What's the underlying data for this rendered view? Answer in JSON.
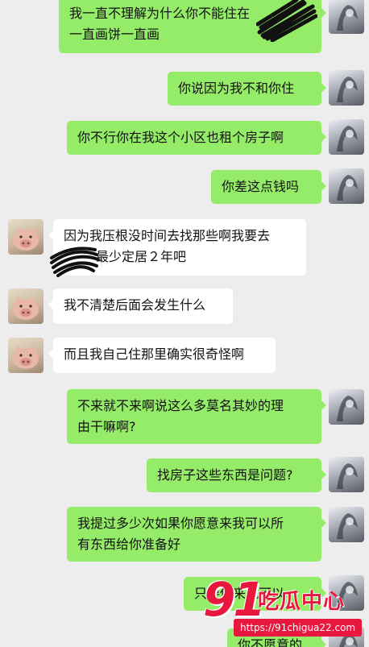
{
  "messages": [
    {
      "side": "self",
      "text": "我一直不理解为什么你不能住在这里，一直画饼一直画"
    },
    {
      "side": "self",
      "text": "你说因为我不和你住"
    },
    {
      "side": "self",
      "text": "你不行你在我这个小区也租个房子啊"
    },
    {
      "side": "self",
      "text": "你差这点钱吗"
    },
    {
      "side": "other",
      "text": "因为我压根没时间去找那些啊我要去 最少定居2年吧"
    },
    {
      "side": "other",
      "text": "我不清楚后面会发生什么"
    },
    {
      "side": "other",
      "text": "而且我自己住那里确实很奇怪啊"
    },
    {
      "side": "self",
      "text": "不来就不来啊说这么多莫名其妙的理由干嘛啊?"
    },
    {
      "side": "self",
      "text": "找房子这些东西是问题?"
    },
    {
      "side": "self",
      "text": "我提过多少次如果你愿意来我可以所有东西给你准备好"
    },
    {
      "side": "self",
      "text": "只要你来就可以"
    },
    {
      "side": "self",
      "text": "你不愿意的"
    }
  ],
  "bubble_lines": {
    "m0": [
      "我一直不理解为什么你不能住在",
      "一直画饼一直画"
    ],
    "m4": [
      "因为我压根没时间去找那些啊我要去",
      "最少定居２年吧"
    ],
    "m7": [
      "不来就不来啊说这么多莫名其妙的理",
      "由干嘛啊?"
    ],
    "m9": [
      "我提过多少次如果你愿意来我可以所",
      "有东西给你准备好"
    ],
    "m10": "只要你来就可以",
    "m11": "你不愿意的"
  },
  "watermark": {
    "number": "91",
    "name": "吃瓜中心",
    "url": "https://91chigua22.com"
  },
  "colors": {
    "background": "#ededed",
    "self_bubble": "#95ec69",
    "other_bubble": "#ffffff",
    "watermark_red": "#e8173d"
  }
}
